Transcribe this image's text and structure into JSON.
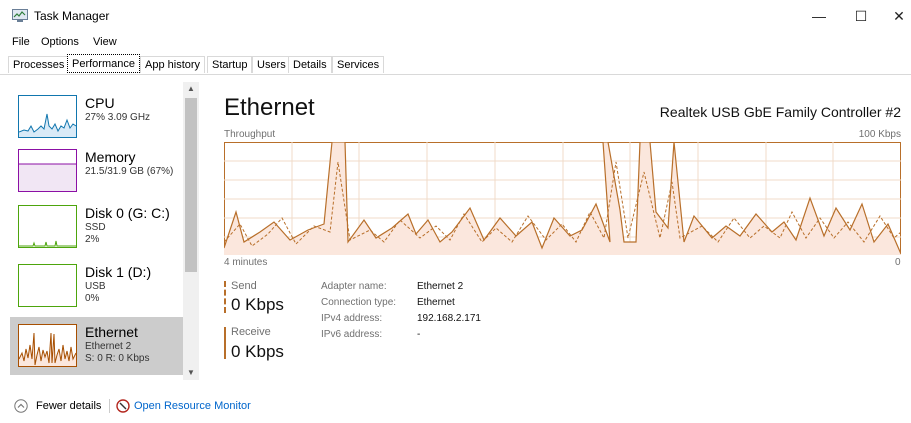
{
  "window": {
    "title": "Task Manager",
    "minimize_glyph": "—",
    "maximize_glyph": "☐",
    "close_glyph": "✕"
  },
  "menu": {
    "file": "File",
    "options": "Options",
    "view": "View"
  },
  "tabs": [
    {
      "label": "Processes",
      "active": false
    },
    {
      "label": "Performance",
      "active": true
    },
    {
      "label": "App history",
      "active": false
    },
    {
      "label": "Startup",
      "active": false
    },
    {
      "label": "Users",
      "active": false
    },
    {
      "label": "Details",
      "active": false
    },
    {
      "label": "Services",
      "active": false
    }
  ],
  "sidebar": {
    "items": [
      {
        "name": "CPU",
        "line1": "27% 3.09 GHz",
        "line2": "",
        "line3": "",
        "icon": "cpu-graph",
        "color": "#1176ae"
      },
      {
        "name": "Memory",
        "line1": "21.5/31.9 GB (67%)",
        "line2": "",
        "line3": "",
        "icon": "memory-graph",
        "color": "#8b0fa5"
      },
      {
        "name": "Disk 0 (G: C:)",
        "line1": "SSD",
        "line2": "2%",
        "line3": "",
        "icon": "disk-graph",
        "color": "#4da50c"
      },
      {
        "name": "Disk 1 (D:)",
        "line1": "USB",
        "line2": "0%",
        "line3": "",
        "icon": "disk-graph",
        "color": "#4da50c"
      },
      {
        "name": "Ethernet",
        "line1": "Ethernet 2",
        "line2": "S: 0 R: 0 Kbps",
        "line3": "",
        "icon": "ethernet-graph",
        "color": "#a74f01",
        "selected": true
      }
    ]
  },
  "detail": {
    "title": "Ethernet",
    "adapter": "Realtek USB GbE Family Controller #2",
    "throughput_label": "Throughput",
    "max_label": "100 Kbps",
    "time_label": "4 minutes",
    "zero_label": "0",
    "send_label": "Send",
    "send_value": "0 Kbps",
    "receive_label": "Receive",
    "receive_value": "0 Kbps",
    "props": [
      {
        "label": "Adapter name:",
        "value": "Ethernet 2"
      },
      {
        "label": "Connection type:",
        "value": "Ethernet"
      },
      {
        "label": "IPv4 address:",
        "value": "192.168.2.171"
      },
      {
        "label": "IPv6 address:",
        "value": "-"
      }
    ]
  },
  "footer": {
    "fewer_details": "Fewer details",
    "resource_monitor": "Open Resource Monitor"
  },
  "colors": {
    "accent": "#b86f2a",
    "graph_fill": "#fbe7dd",
    "grid": "#f0dbc8"
  }
}
